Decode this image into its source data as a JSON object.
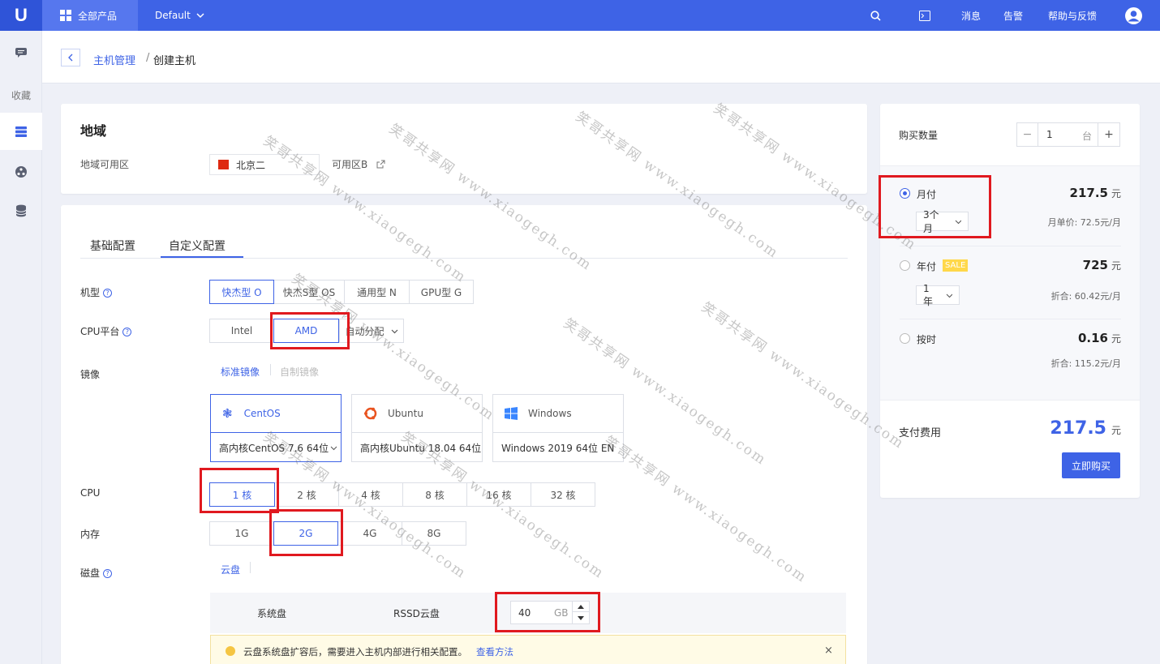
{
  "topbar": {
    "logo": "U",
    "all_products": "全部产品",
    "project": "Default",
    "messages": "消息",
    "alerts": "告警",
    "help": "帮助与反馈"
  },
  "sidebar": {
    "favorites": "收藏"
  },
  "breadcrumb": {
    "parent": "主机管理",
    "separator": "/",
    "current": "创建主机"
  },
  "region": {
    "title": "地域",
    "label": "地域可用区",
    "region": "北京二",
    "zone": "可用区B"
  },
  "config": {
    "tabs": [
      "基础配置",
      "自定义配置"
    ],
    "machine_type_label": "机型",
    "machine_types": [
      "快杰型 O",
      "快杰S型 OS",
      "通用型 N",
      "GPU型 G"
    ],
    "cpu_platform_label": "CPU平台",
    "cpu_platforms": [
      "Intel",
      "AMD"
    ],
    "cpu_platform_auto": "自动分配",
    "image_label": "镜像",
    "image_tabs": [
      "标准镜像",
      "自制镜像"
    ],
    "os": [
      {
        "name": "CentOS",
        "version": "高内核CentOS 7.6 64位"
      },
      {
        "name": "Ubuntu",
        "version": "高内核Ubuntu 18.04 64位"
      },
      {
        "name": "Windows",
        "version": "Windows 2019 64位 EN"
      }
    ],
    "cpu_label": "CPU",
    "cpu_options": [
      "1 核",
      "2 核",
      "4 核",
      "8 核",
      "16 核",
      "32 核"
    ],
    "memory_label": "内存",
    "memory_options": [
      "1G",
      "2G",
      "4G",
      "8G"
    ],
    "disk_label": "磁盘",
    "disk_tab": "云盘",
    "system_disk": "系统盘",
    "disk_type": "RSSD云盘",
    "disk_size": "40",
    "disk_unit": "GB",
    "notice": "云盘系统盘扩容后，需要进入主机内部进行相关配置。",
    "notice_link": "查看方法"
  },
  "order": {
    "qty_label": "购买数量",
    "qty": "1",
    "qty_unit": "台",
    "monthly": {
      "label": "月付",
      "price": "217.5",
      "unit": "元",
      "period": "3个月",
      "sub": "月单价: 72.5元/月"
    },
    "yearly": {
      "label": "年付",
      "badge": "SALE",
      "price": "725",
      "unit": "元",
      "period": "1年",
      "sub": "折合: 60.42元/月"
    },
    "hourly": {
      "label": "按时",
      "price": "0.16",
      "unit": "元",
      "sub": "折合: 115.2元/月"
    },
    "total_label": "支付费用",
    "total": "217.5",
    "total_unit": "元",
    "buy": "立即购买"
  },
  "watermark": "笑哥共享网 www.xiaogegh.com",
  "colors": {
    "primary": "#3e63e6",
    "highlight": "#e0191f",
    "sale": "#ffd84a"
  }
}
